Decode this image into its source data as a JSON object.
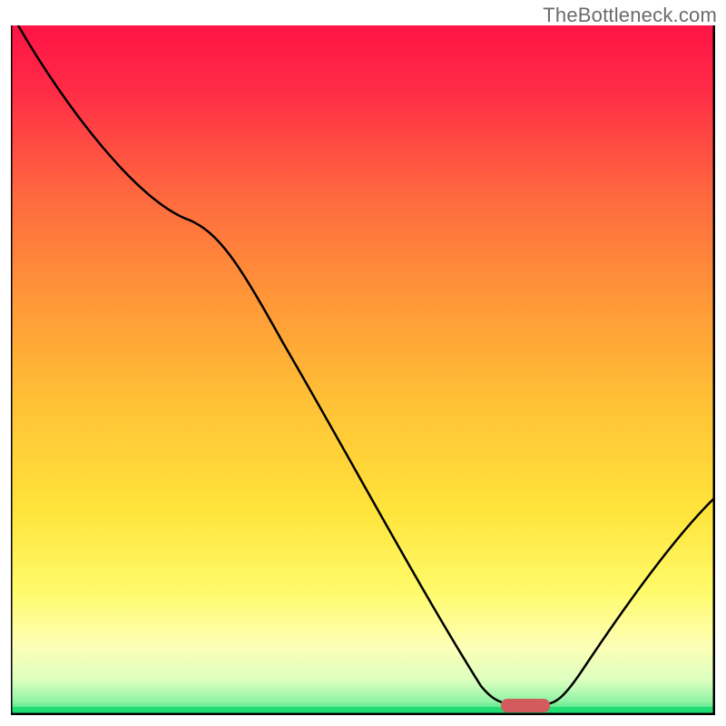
{
  "watermark": "TheBottleneck.com",
  "chart_data": {
    "type": "line",
    "title": "",
    "xlabel": "",
    "ylabel": "",
    "xlim": [
      0,
      100
    ],
    "ylim": [
      0,
      100
    ],
    "grid": false,
    "legend": false,
    "x": [
      0,
      25,
      68,
      75,
      100
    ],
    "values": [
      100,
      72,
      0,
      0,
      30
    ],
    "marker": {
      "x_start": 68,
      "x_end": 75,
      "y": 0,
      "color": "#d35b5e"
    },
    "gradient_stops": [
      {
        "pos": 0,
        "color": "#ff1445"
      },
      {
        "pos": 50,
        "color": "#ffa637"
      },
      {
        "pos": 72,
        "color": "#ffe73a"
      },
      {
        "pos": 88,
        "color": "#fffd94"
      },
      {
        "pos": 95,
        "color": "#f7ffd2"
      },
      {
        "pos": 100,
        "color": "#2fe47a"
      }
    ]
  }
}
